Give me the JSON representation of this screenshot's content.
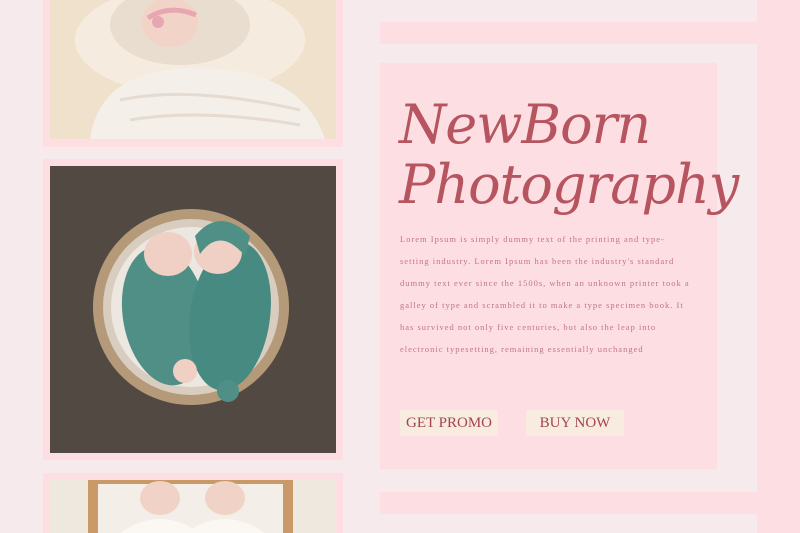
{
  "hero": {
    "title_line1": "NewBorn",
    "title_line2": "Photography",
    "description": "Lorem Ipsum is simply dummy text of the printing and type-setting industry. Lorem Ipsum has been the industry's standard dummy text ever since the 1500s, when an unknown printer took a galley of type and scrambled it to make a type specimen book. It has survived not only five centuries, but also the leap into electronic typesetting, remaining essentially unchanged"
  },
  "buttons": {
    "promo_label": "GET PROMO",
    "buy_label": "BUY NOW"
  },
  "colors": {
    "background": "#f7eaec",
    "panel_pink": "#fddfe3",
    "title": "#b65560",
    "body_text": "#c27580",
    "button_bg": "#f7ecdf",
    "button_text": "#a4444f"
  }
}
